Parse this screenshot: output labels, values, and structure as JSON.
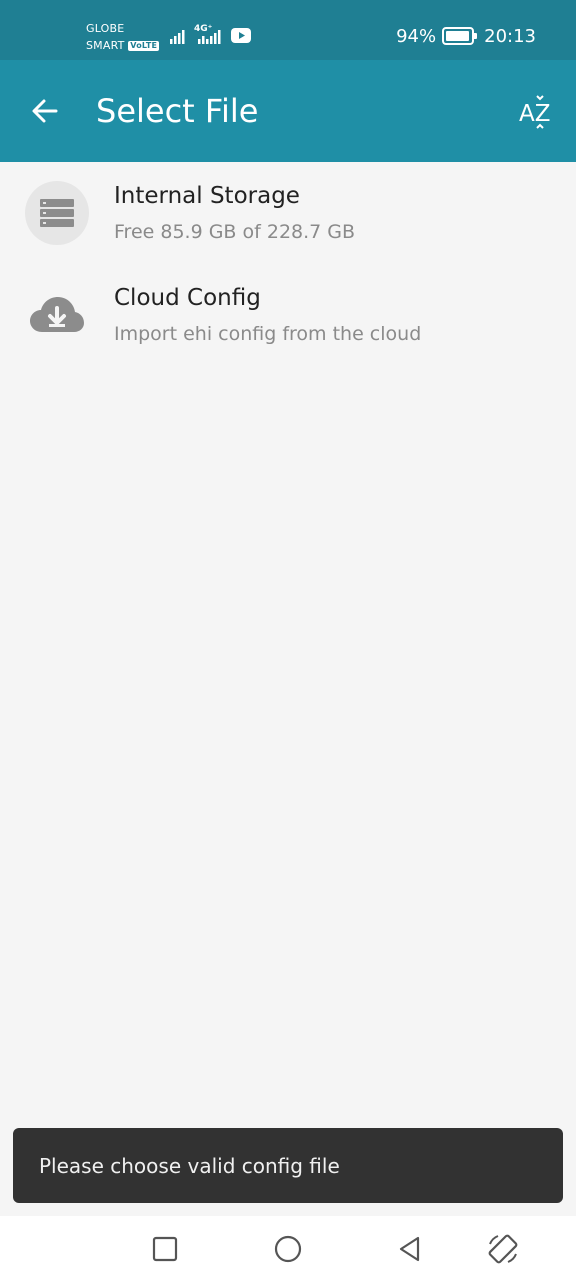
{
  "status_bar": {
    "carrier_line1": "GLOBE",
    "carrier_line2": "SMART",
    "volte": "VoLTE",
    "network": "4G⁺",
    "battery": "94%",
    "battery_fraction": 0.94,
    "time": "20:13"
  },
  "app_bar": {
    "title": "Select File",
    "back_icon": "arrow-left-icon",
    "sort_icon": "sort-az-icon",
    "sort_label": "AZ"
  },
  "items": [
    {
      "title": "Internal Storage",
      "subtitle": "Free 85.9 GB of 228.7 GB",
      "icon": "storage-icon"
    },
    {
      "title": "Cloud Config",
      "subtitle": "Import ehi config from the cloud",
      "icon": "cloud-download-icon"
    }
  ],
  "snackbar": {
    "message": "Please choose valid config file"
  },
  "nav_bar": {
    "icons": [
      "recent-apps-icon",
      "home-icon",
      "back-triangle-icon",
      "rotate-screen-icon"
    ]
  },
  "colors": {
    "status_bar": "#1f7f93",
    "app_bar": "#1f8fa6",
    "background": "#f5f5f5",
    "snackbar": "#323232"
  }
}
